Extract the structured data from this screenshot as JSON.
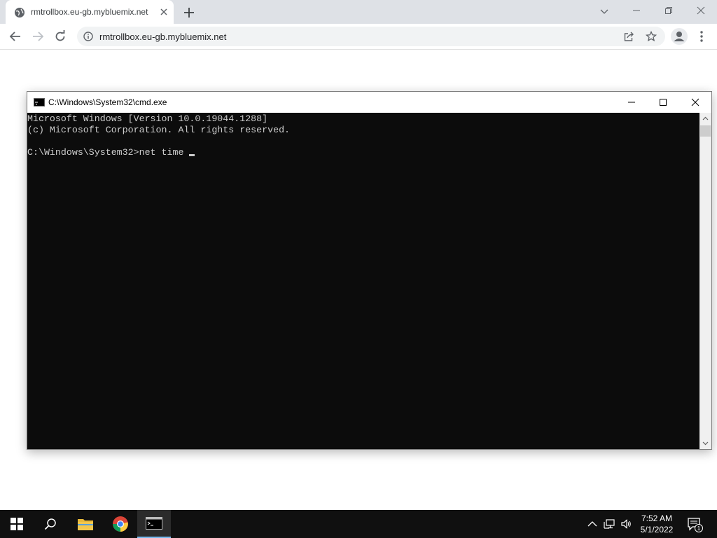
{
  "browser": {
    "tab_title": "rmtrollbox.eu-gb.mybluemix.net",
    "url": "rmtrollbox.eu-gb.mybluemix.net"
  },
  "cmd": {
    "title": "C:\\Windows\\System32\\cmd.exe",
    "lines": [
      "Microsoft Windows [Version 10.0.19044.1288]",
      "(c) Microsoft Corporation. All rights reserved.",
      "",
      "C:\\Windows\\System32>net time "
    ]
  },
  "taskbar": {
    "time": "7:52 AM",
    "date": "5/1/2022",
    "notification_count": "1"
  },
  "colors": {
    "console_bg": "#0c0c0c",
    "console_fg": "#cccccc",
    "taskbar_bg": "#101010",
    "tab_strip_bg": "#dee1e6"
  }
}
